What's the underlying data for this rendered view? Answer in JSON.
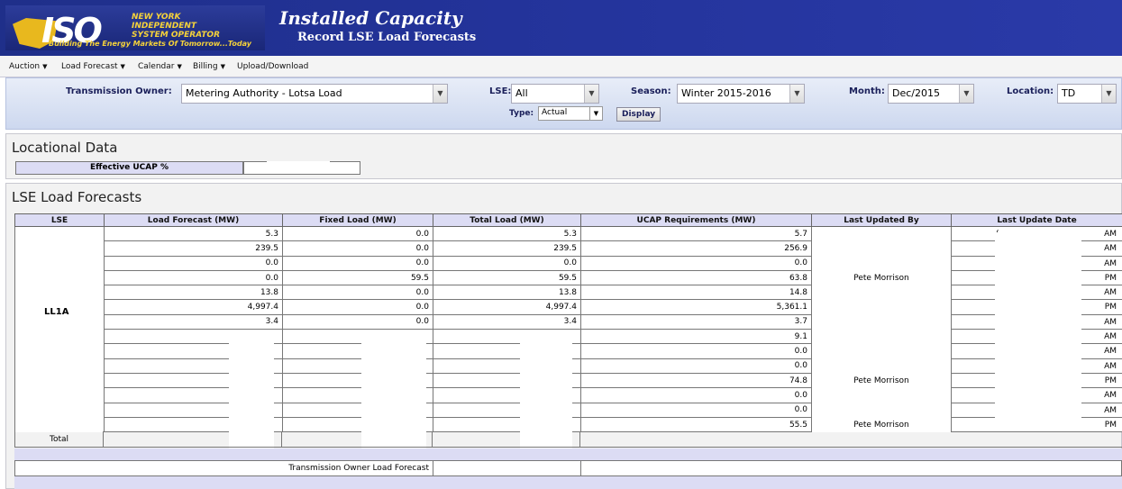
{
  "header": {
    "logo_iso": "ISO",
    "logo_line1": "NEW YORK",
    "logo_line2": "INDEPENDENT",
    "logo_line3": "SYSTEM OPERATOR",
    "logo_tagline": "Building The Energy Markets Of Tomorrow...Today",
    "title": "Installed Capacity",
    "subtitle": "Record LSE Load Forecasts"
  },
  "nav": {
    "items": [
      {
        "label": "Auction",
        "has_dropdown": true
      },
      {
        "label": "Load Forecast",
        "has_dropdown": true
      },
      {
        "label": "Calendar",
        "has_dropdown": true
      },
      {
        "label": "Billing",
        "has_dropdown": true
      },
      {
        "label": "Upload/Download",
        "has_dropdown": false
      }
    ]
  },
  "filters": {
    "transmission_owner_label": "Transmission Owner:",
    "transmission_owner_value": "Metering Authority - Lotsa Load",
    "lse_label": "LSE:",
    "lse_value": "All",
    "season_label": "Season:",
    "season_value": "Winter 2015-2016",
    "month_label": "Month:",
    "month_value": "Dec/2015",
    "location_label": "Location:",
    "location_value": "TD",
    "type_label": "Type:",
    "type_value": "Actual",
    "display_button": "Display"
  },
  "locational": {
    "title": "Locational Data",
    "effective_ucap_label": "Effective UCAP %"
  },
  "forecasts": {
    "title": "LSE Load Forecasts",
    "columns": [
      "LSE",
      "Load Forecast (MW)",
      "Fixed Load (MW)",
      "Total Load (MW)",
      "UCAP Requirements (MW)",
      "Last Updated By",
      "Last Update Date"
    ],
    "lse_name": "LL1A",
    "rows": [
      {
        "load": "5.3",
        "fixed": "0.0",
        "total": "5.3",
        "ucap": "5.7",
        "by": "",
        "ampm": "AM"
      },
      {
        "load": "239.5",
        "fixed": "0.0",
        "total": "239.5",
        "ucap": "256.9",
        "by": "",
        "ampm": "AM"
      },
      {
        "load": "0.0",
        "fixed": "0.0",
        "total": "0.0",
        "ucap": "0.0",
        "by": "",
        "ampm": "AM"
      },
      {
        "load": "0.0",
        "fixed": "59.5",
        "total": "59.5",
        "ucap": "63.8",
        "by": "Pete Morrison",
        "ampm": "PM"
      },
      {
        "load": "13.8",
        "fixed": "0.0",
        "total": "13.8",
        "ucap": "14.8",
        "by": "",
        "ampm": "AM"
      },
      {
        "load": "4,997.4",
        "fixed": "0.0",
        "total": "4,997.4",
        "ucap": "5,361.1",
        "by": "",
        "ampm": "PM"
      },
      {
        "load": "3.4",
        "fixed": "0.0",
        "total": "3.4",
        "ucap": "3.7",
        "by": "",
        "ampm": "AM"
      },
      {
        "load": "",
        "fixed": "",
        "total": "",
        "ucap": "9.1",
        "by": "",
        "ampm": "AM"
      },
      {
        "load": "",
        "fixed": "",
        "total": "",
        "ucap": "0.0",
        "by": "",
        "ampm": "AM"
      },
      {
        "load": "",
        "fixed": "",
        "total": "",
        "ucap": "0.0",
        "by": "",
        "ampm": "AM"
      },
      {
        "load": "",
        "fixed": "",
        "total": "",
        "ucap": "74.8",
        "by": "Pete Morrison",
        "ampm": "PM"
      },
      {
        "load": "",
        "fixed": "",
        "total": "",
        "ucap": "0.0",
        "by": "",
        "ampm": "AM"
      },
      {
        "load": "",
        "fixed": "",
        "total": "",
        "ucap": "0.0",
        "by": "",
        "ampm": "AM"
      },
      {
        "load": "",
        "fixed": "",
        "total": "",
        "ucap": "55.5",
        "by": "Pete Morrison",
        "ampm": "PM"
      }
    ],
    "date_prefix": "(",
    "total_label": "Total",
    "to_forecast_label": "Transmission Owner Load Forecast"
  },
  "colors": {
    "banner": "#23339a",
    "header_cell": "#dcdcf4",
    "logo_accent": "#f5d23a"
  }
}
